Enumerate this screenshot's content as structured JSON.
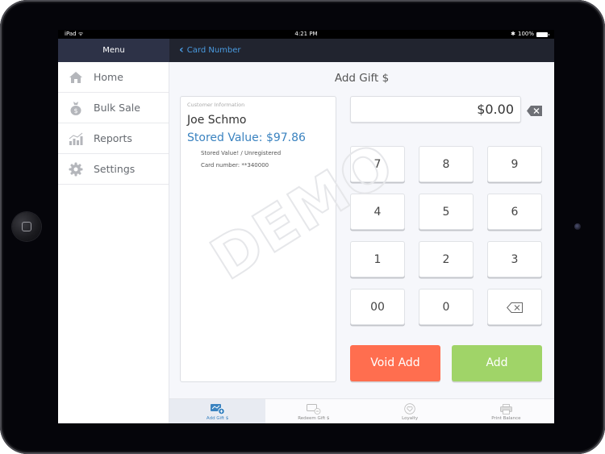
{
  "status_bar": {
    "device": "iPad",
    "time": "4:21 PM",
    "battery": "100%"
  },
  "nav": {
    "menu_title": "Menu",
    "back_label": "Card Number"
  },
  "sidebar": {
    "items": [
      {
        "label": "Home",
        "icon": "home-icon"
      },
      {
        "label": "Bulk Sale",
        "icon": "money-bag-icon"
      },
      {
        "label": "Reports",
        "icon": "chart-icon"
      },
      {
        "label": "Settings",
        "icon": "gear-icon"
      }
    ]
  },
  "main": {
    "title": "Add Gift $",
    "customer": {
      "caption": "Customer Information",
      "name": "Joe Schmo",
      "stored_value": "Stored Value: $97.86",
      "status": "Stored Value! / Unregistered",
      "card_number": "Card number: **340000"
    },
    "amount": "$0.00",
    "keypad": [
      "7",
      "8",
      "9",
      "4",
      "5",
      "6",
      "1",
      "2",
      "3",
      "00",
      "0",
      "⌫"
    ],
    "void_label": "Void Add",
    "add_label": "Add",
    "watermark": "DEMO"
  },
  "tabs": [
    {
      "label": "Add Gift $",
      "icon": "add-gift-card-icon",
      "active": true
    },
    {
      "label": "Redeem Gift $",
      "icon": "redeem-gift-card-icon",
      "active": false
    },
    {
      "label": "Loyalty",
      "icon": "heart-icon",
      "active": false
    },
    {
      "label": "Print Balance",
      "icon": "printer-icon",
      "active": false
    }
  ],
  "colors": {
    "accent": "#3b83c0",
    "void": "#ff6e4f",
    "add": "#a0d468",
    "nav_bg": "#21242f",
    "menu_bg": "#2d3247"
  }
}
